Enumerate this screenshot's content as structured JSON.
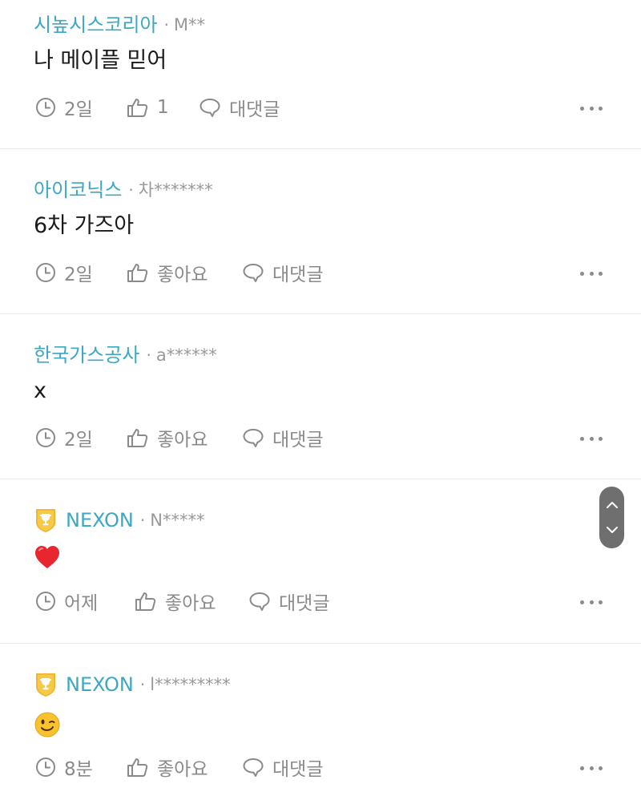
{
  "colors": {
    "company": "#3ea7c2",
    "meta": "#999999",
    "body": "#1a1a1a",
    "action": "#8a8a8a",
    "divider": "#e9e9e9"
  },
  "comments": [
    {
      "company": "시높시스코리아",
      "separator": "·",
      "user": "M**",
      "text": "나 메이플 믿어",
      "time": "2일",
      "like_label": "1",
      "reply_label": "대댓글"
    },
    {
      "company": "아이코닉스",
      "separator": "·",
      "user": "차*******",
      "text": "6차 가즈아",
      "time": "2일",
      "like_label": "좋아요",
      "reply_label": "대댓글"
    },
    {
      "company": "한국가스공사",
      "separator": "·",
      "user": "a******",
      "text": "x",
      "time": "2일",
      "like_label": "좋아요",
      "reply_label": "대댓글"
    },
    {
      "badge_icon": "trophy-badge-icon",
      "company": "NEXON",
      "separator": "·",
      "user": "N*****",
      "emoji_icon": "red-heart-emoji",
      "time": "어제",
      "like_label": "좋아요",
      "reply_label": "대댓글"
    },
    {
      "badge_icon": "trophy-badge-icon",
      "company": "NEXON",
      "separator": "·",
      "user": "l*********",
      "emoji_icon": "winking-face-emoji",
      "time": "8분",
      "like_label": "좋아요",
      "reply_label": "대댓글"
    }
  ],
  "scroll_controls": {
    "up_icon": "chevron-up-icon",
    "down_icon": "chevron-down-icon"
  }
}
